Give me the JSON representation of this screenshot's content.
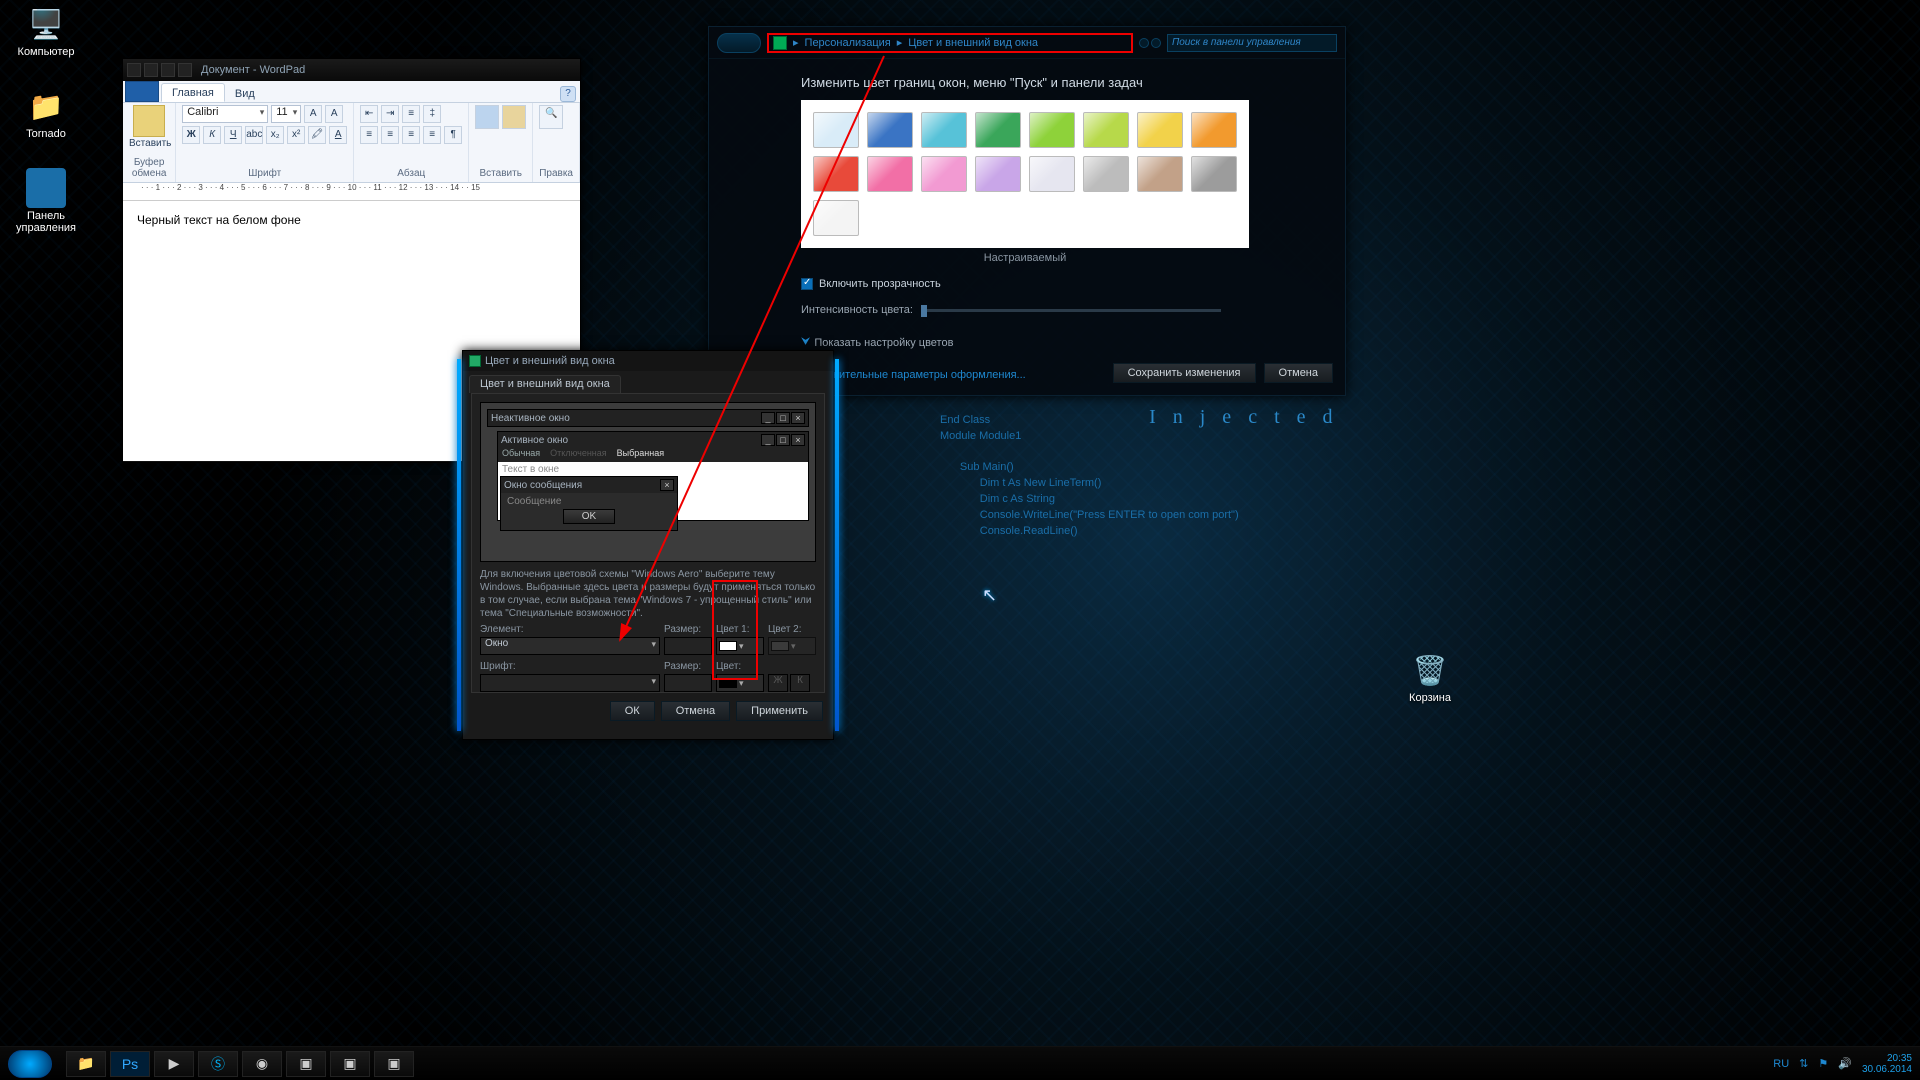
{
  "desktop": {
    "computer": "Компьютер",
    "tornado": "Tornado",
    "panel": "Панель управления",
    "recycle": "Корзина"
  },
  "bgcode": {
    "injected": "I n j e c t e d",
    "l1": "End Class",
    "l2": "Module Module1",
    "l3": "Sub Main()",
    "l4": "Dim t As New LineTerm()",
    "l5": "Dim c As String",
    "l6": "Console.WriteLine(\"Press ENTER to open com port\")",
    "l7": "Console.ReadLine()"
  },
  "wordpad": {
    "title": "Документ - WordPad",
    "tab_home": "Главная",
    "tab_view": "Вид",
    "group_clipboard": "Буфер обмена",
    "paste": "Вставить",
    "group_font": "Шрифт",
    "font": "Calibri",
    "size": "11",
    "group_para": "Абзац",
    "group_insert": "Вставить",
    "group_edit": "Правка",
    "body_text": "Черный текст на белом фоне",
    "ruler": "· · · 1 · · · 2 · · · 3 · · · 4 · · · 5 · · · 6 · · · 7 · · · 8 · · · 9 · · · 10 · · · 11 · · · 12 · · · 13 · · · 14 · · 15"
  },
  "perso": {
    "crumb1": "Персонализация",
    "crumb2": "Цвет и внешний вид окна",
    "search_ph": "Поиск в панели управления",
    "heading": "Изменить цвет границ окон, меню \"Пуск\" и панели задач",
    "caption": "Настраиваемый",
    "transparency": "Включить прозрачность",
    "intensity": "Интенсивность цвета:",
    "show_mixer": "Показать настройку цветов",
    "advanced": "Дополнительные параметры оформления...",
    "save": "Сохранить изменения",
    "cancel": "Отмена",
    "sw": [
      "#d9ecf8",
      "#3a74c4",
      "#57c2d8",
      "#3aa65a",
      "#8ed23a",
      "#b7d94a",
      "#f2d24a",
      "#f29a2e",
      "#e84a3a",
      "#f26fa6",
      "#f29ad2",
      "#c9a6e8",
      "#e6e6f0",
      "#bcbcbc",
      "#c2a188",
      "#9c9c9c",
      "#f4f4f4"
    ]
  },
  "appdlg": {
    "title": "Цвет и внешний вид окна",
    "tab": "Цвет и внешний вид окна",
    "inactive": "Неактивное окно",
    "active": "Активное окно",
    "menu_normal": "Обычная",
    "menu_disabled": "Отключенная",
    "menu_selected": "Выбранная",
    "window_text": "Текст в окне",
    "msgbox_title": "Окно сообщения",
    "msgbox_text": "Сообщение",
    "ok": "OK",
    "desc": "Для включения цветовой схемы \"Windows Aero\" выберите тему Windows. Выбранные здесь цвета и размеры будут применяться только в том случае, если выбрана тема \"Windows 7 - упрощенный стиль\" или тема \"Специальные возможности\".",
    "lbl_element": "Элемент:",
    "lbl_size": "Размер:",
    "lbl_color1": "Цвет 1:",
    "lbl_color2": "Цвет 2:",
    "lbl_font": "Шрифт:",
    "lbl_fcolor": "Цвет:",
    "val_element": "Окно",
    "btn_ok": "ОК",
    "btn_cancel": "Отмена",
    "btn_apply": "Применить"
  },
  "taskbar": {
    "lang": "RU",
    "time": "20:35",
    "date": "30.06.2014"
  }
}
